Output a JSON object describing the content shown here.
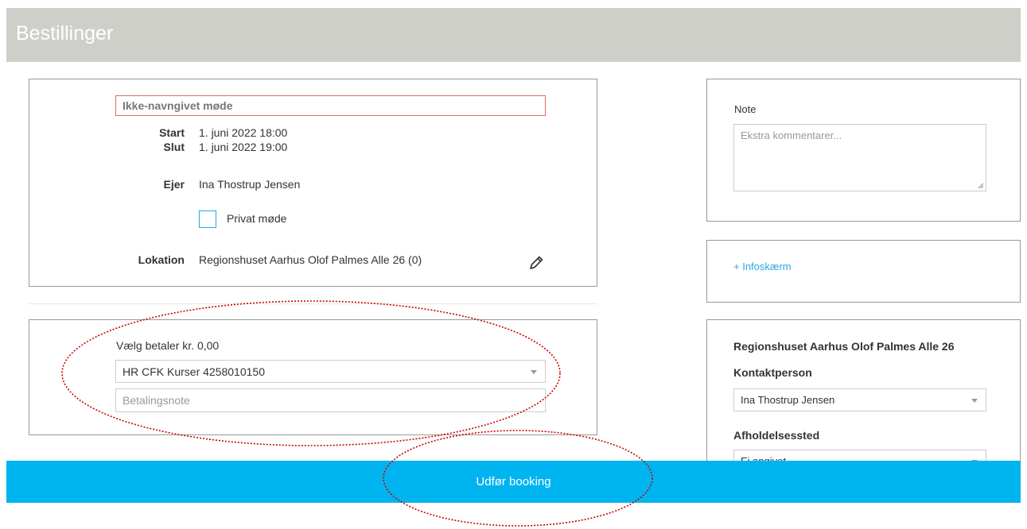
{
  "header": {
    "title": "Bestillinger"
  },
  "meeting": {
    "title": "Ikke-navngivet møde",
    "start_label": "Start",
    "start_value": "1. juni 2022 18:00",
    "end_label": "Slut",
    "end_value": "1. juni 2022 19:00",
    "owner_label": "Ejer",
    "owner_value": "Ina Thostrup Jensen",
    "private_label": "Privat møde",
    "location_label": "Lokation",
    "location_value": "Regionshuset Aarhus Olof Palmes Alle 26 (0)"
  },
  "payment": {
    "label": "Vælg betaler kr. 0,00",
    "payer_selected": "HR CFK Kurser 4258010150",
    "note_placeholder": "Betalingsnote"
  },
  "note": {
    "label": "Note",
    "placeholder": "Ekstra kommentarer..."
  },
  "infoscreen": {
    "link": "+ Infoskærm"
  },
  "location_panel": {
    "title": "Regionshuset Aarhus Olof Palmes Alle 26",
    "contact_label": "Kontaktperson",
    "contact_selected": "Ina Thostrup Jensen",
    "venue_label": "Afholdelsessted",
    "venue_selected": "Ej angivet"
  },
  "footer": {
    "book_button": "Udfør booking"
  },
  "colors": {
    "header_bg": "#cfcfca",
    "accent": "#00b4f0",
    "link": "#2ba6e4",
    "annotation": "#cc0000"
  }
}
